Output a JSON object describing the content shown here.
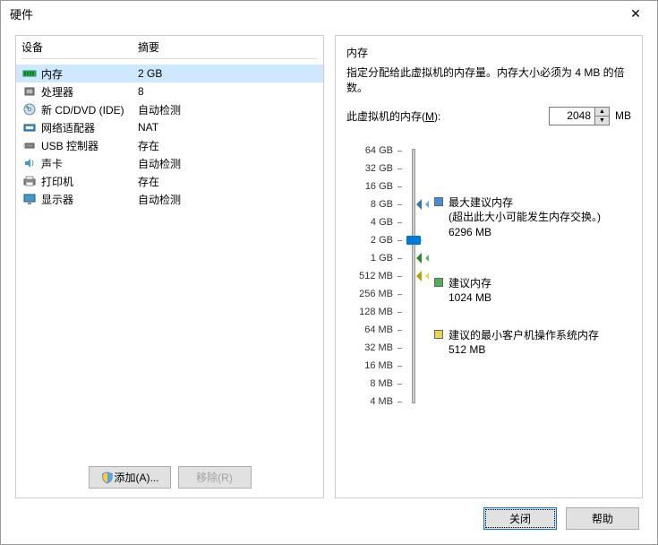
{
  "window": {
    "title": "硬件",
    "close": "✕"
  },
  "left": {
    "th_device": "设备",
    "th_summary": "摘要",
    "devices": [
      {
        "name": "内存",
        "summary": "2 GB",
        "selected": true,
        "icon": "memory"
      },
      {
        "name": "处理器",
        "summary": "8",
        "icon": "cpu"
      },
      {
        "name": "新 CD/DVD (IDE)",
        "summary": "自动检测",
        "icon": "disc"
      },
      {
        "name": "网络适配器",
        "summary": "NAT",
        "icon": "net"
      },
      {
        "name": "USB 控制器",
        "summary": "存在",
        "icon": "usb"
      },
      {
        "name": "声卡",
        "summary": "自动检测",
        "icon": "sound"
      },
      {
        "name": "打印机",
        "summary": "存在",
        "icon": "printer"
      },
      {
        "name": "显示器",
        "summary": "自动检测",
        "icon": "display"
      }
    ],
    "btn_add": "添加(A)...",
    "btn_remove": "移除(R)"
  },
  "right": {
    "title": "内存",
    "desc": "指定分配给此虚拟机的内存量。内存大小必须为 4 MB 的倍数。",
    "input_label_pre": "此虚拟机的内存(",
    "input_accel": "M",
    "input_label_post": "):",
    "value": "2048",
    "unit": "MB",
    "ticks": [
      "64 GB",
      "32 GB",
      "16 GB",
      "8 GB",
      "4 GB",
      "2 GB",
      "1 GB",
      "512 MB",
      "256 MB",
      "128 MB",
      "64 MB",
      "32 MB",
      "16 MB",
      "8 MB",
      "4 MB"
    ],
    "legend": {
      "max": {
        "title": "最大建议内存",
        "note": "(超出此大小可能发生内存交换。)",
        "value": "6296 MB"
      },
      "rec": {
        "title": "建议内存",
        "value": "1024 MB"
      },
      "min": {
        "title": "建议的最小客户机操作系统内存",
        "value": "512 MB"
      }
    }
  },
  "footer": {
    "close": "关闭",
    "help": "帮助"
  }
}
